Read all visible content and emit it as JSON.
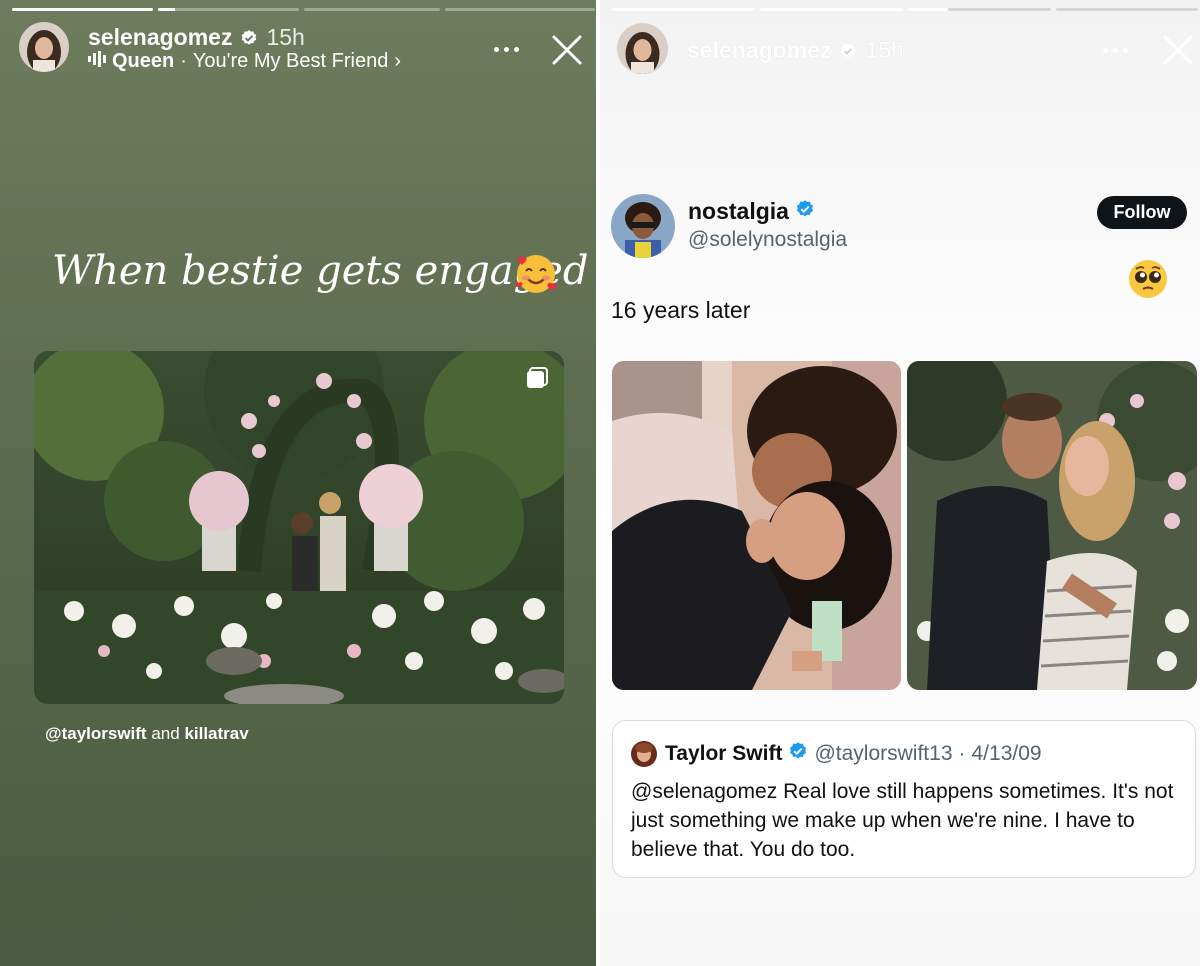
{
  "left_story": {
    "progress": [
      {
        "fill": 1.0
      },
      {
        "fill": 0.12
      },
      {
        "fill": 0.0
      },
      {
        "fill": 0.0
      }
    ],
    "username": "selenagomez",
    "time": "15h",
    "music": {
      "song": "Queen",
      "separator": "·",
      "title": "You're My Best Friend",
      "chevron": "›"
    },
    "caption": "When bestie gets engaged",
    "caption_emoji": "smiling-face-with-hearts-icon",
    "tags": {
      "user1": "@taylorswift",
      "joiner": "and",
      "user2": "killatrav"
    }
  },
  "right_story": {
    "progress": [
      {
        "fill": 1.0
      },
      {
        "fill": 1.0
      },
      {
        "fill": 0.28
      },
      {
        "fill": 0.0
      }
    ],
    "username": "selenagomez",
    "time": "15h",
    "tweet": {
      "name": "nostalgia",
      "handle": "@solelynostalgia",
      "follow_label": "Follow",
      "text": "16 years later",
      "reaction_emoji": "pleading-face-icon"
    },
    "quoted_tweet": {
      "name": "Taylor Swift",
      "handle": "@taylorswift13",
      "separator": "·",
      "date": "4/13/09",
      "text": "@selenagomez Real love still happens sometimes. It's not just something we make up when we're nine. I have to believe that. You do too."
    }
  },
  "colors": {
    "verified_white": "#ffffff",
    "verified_blue": "#1d9bf0",
    "follow_button": "#0f1419",
    "left_background": "#5c6c4e"
  }
}
